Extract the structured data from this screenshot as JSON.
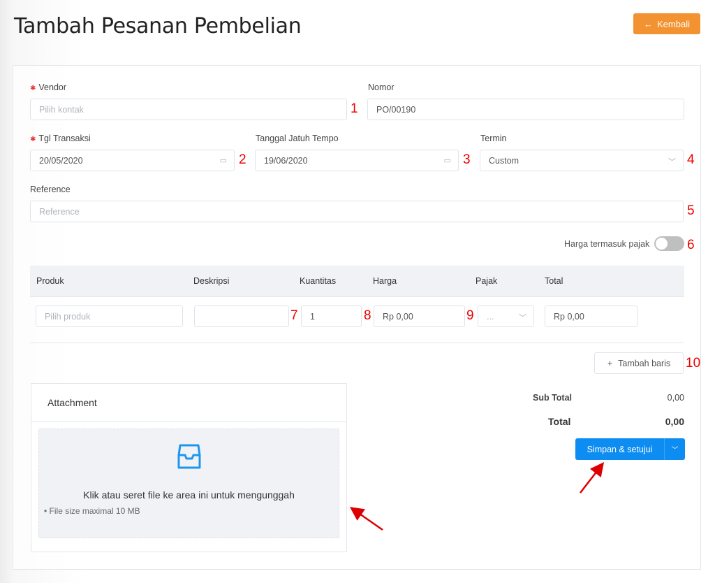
{
  "header": {
    "title": "Tambah Pesanan Pembelian",
    "back_label": "Kembali",
    "back_icon": "arrow-left-icon"
  },
  "form": {
    "vendor": {
      "label": "Vendor",
      "required": true,
      "placeholder": "Pilih kontak"
    },
    "nomor": {
      "label": "Nomor",
      "value": "PO/00190"
    },
    "tgl_transaksi": {
      "label": "Tgl Transaksi",
      "required": true,
      "value": "20/05/2020",
      "icon": "calendar-icon"
    },
    "jatuh_tempo": {
      "label": "Tanggal Jatuh Tempo",
      "value": "19/06/2020",
      "icon": "calendar-icon"
    },
    "termin": {
      "label": "Termin",
      "value": "Custom",
      "icon": "chevron-down-icon"
    },
    "reference": {
      "label": "Reference",
      "placeholder": "Reference"
    },
    "tax_toggle": {
      "label": "Harga termasuk pajak",
      "on": false
    }
  },
  "table": {
    "columns": [
      "Produk",
      "Deskripsi",
      "Kuantitas",
      "Harga",
      "Pajak",
      "Total"
    ],
    "row": {
      "produk_placeholder": "Pilih produk",
      "deskripsi": "",
      "kuantitas": "1",
      "harga": "Rp 0,00",
      "pajak": "...",
      "total": "Rp 0,00"
    },
    "add_row_label": "Tambah baris"
  },
  "attachment": {
    "title": "Attachment",
    "drop_text": "Klik atau seret file ke area ini untuk mengunggah",
    "note": "File size maximal 10 MB",
    "icon": "inbox-icon"
  },
  "summary": {
    "subtotal_label": "Sub Total",
    "subtotal": "0,00",
    "total_label": "Total",
    "total": "0,00"
  },
  "save_label": "Simpan & setujui",
  "annotations": [
    "1",
    "2",
    "3",
    "4",
    "5",
    "6",
    "7",
    "8",
    "9",
    "10"
  ],
  "colors": {
    "accent_orange": "#f39230",
    "primary_blue": "#0d8df2",
    "annotation_red": "#e00000"
  }
}
